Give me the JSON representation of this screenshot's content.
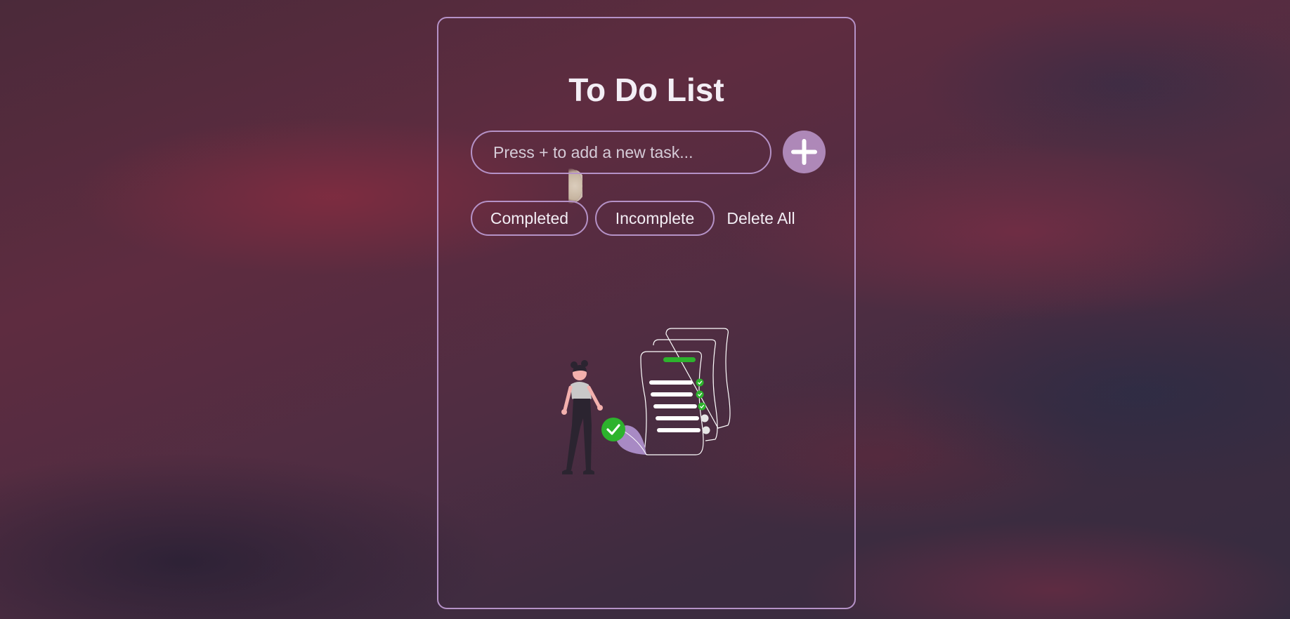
{
  "app": {
    "title": "To Do List"
  },
  "task_input": {
    "placeholder": "Press + to add a new task...",
    "value": ""
  },
  "add_button": {
    "icon": "plus-icon",
    "accent_color": "#ae88b8"
  },
  "filters": {
    "completed_label": "Completed",
    "incomplete_label": "Incomplete",
    "delete_all_label": "Delete All"
  },
  "colors": {
    "border": "#b592c7",
    "text": "#f3eef5",
    "check_green": "#2db32d",
    "leaf_purple": "#a88ac4"
  },
  "illustration": {
    "icon": "empty-task-list-illustration"
  }
}
